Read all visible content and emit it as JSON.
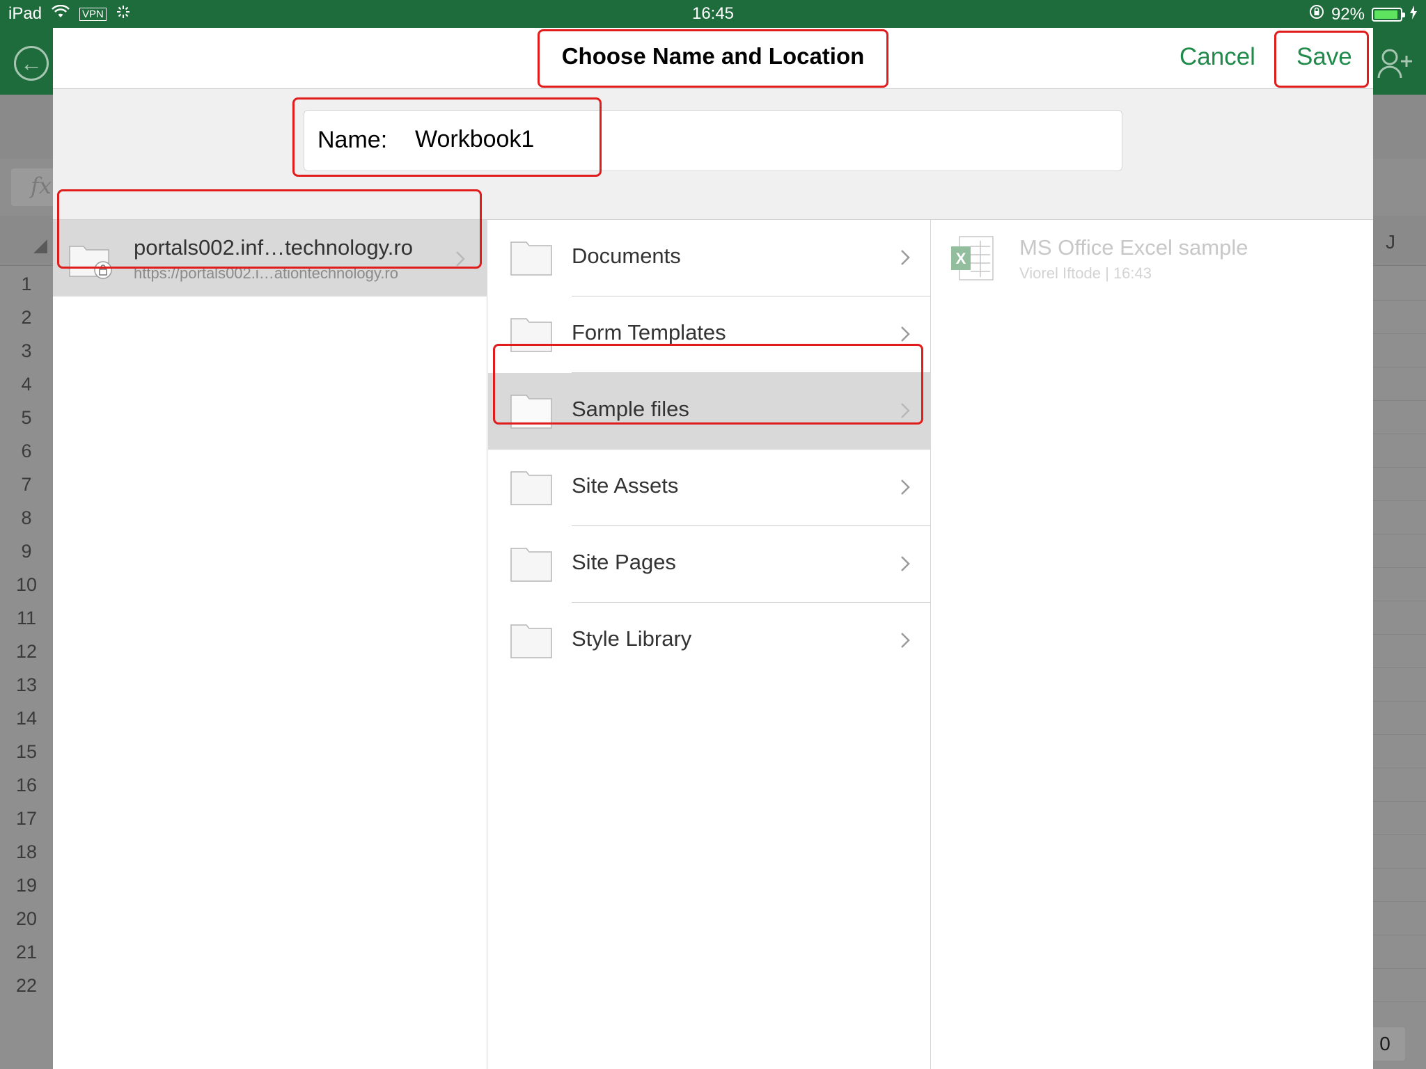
{
  "status_bar": {
    "device": "iPad",
    "vpn": "VPN",
    "time": "16:45",
    "battery": "92%",
    "battery_level": 0.92
  },
  "background_sheet": {
    "column_label": "J",
    "fx_label": "fx",
    "row_numbers": [
      "1",
      "2",
      "3",
      "4",
      "5",
      "6",
      "7",
      "8",
      "9",
      "10",
      "11",
      "12",
      "13",
      "14",
      "15",
      "16",
      "17",
      "18",
      "19",
      "20",
      "21",
      "22"
    ],
    "sheet_indicator": "0"
  },
  "dialog": {
    "title": "Choose Name and Location",
    "cancel_label": "Cancel",
    "save_label": "Save",
    "name_label": "Name:",
    "name_value": "Workbook1"
  },
  "location": {
    "title": "portals002.inf…technology.ro",
    "subtitle": "https://portals002.i…ationtechnology.ro"
  },
  "folders": [
    {
      "label": "Documents",
      "selected": false
    },
    {
      "label": "Form Templates",
      "selected": false
    },
    {
      "label": "Sample files",
      "selected": true
    },
    {
      "label": "Site Assets",
      "selected": false
    },
    {
      "label": "Site Pages",
      "selected": false
    },
    {
      "label": "Style Library",
      "selected": false
    }
  ],
  "files": [
    {
      "title": "MS Office Excel sample",
      "subtitle": "Viorel Iftode | 16:43",
      "icon": "excel-file-icon"
    }
  ],
  "colors": {
    "brand_green": "#1e6b3b",
    "action_green": "#1f8a4a",
    "highlight_red": "#e01c1c"
  }
}
